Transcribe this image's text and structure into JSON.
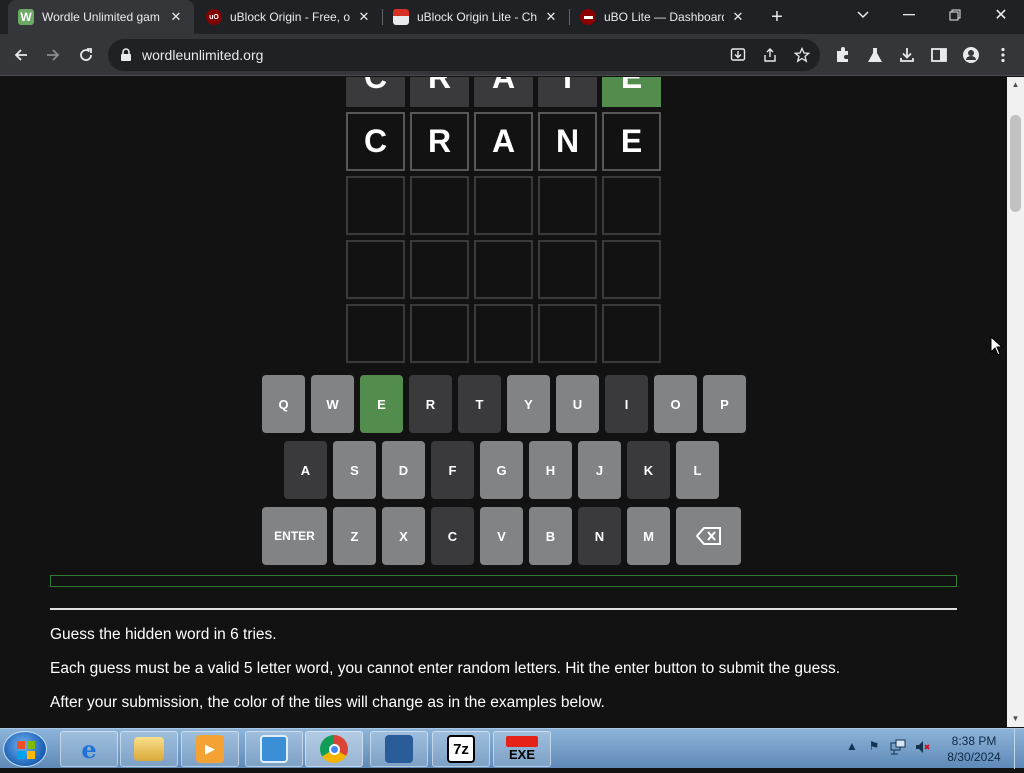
{
  "tabs": [
    {
      "title": "Wordle Unlimited gam",
      "favicon": "W",
      "active": true
    },
    {
      "title": "uBlock Origin - Free, o",
      "favicon": "uO",
      "active": false
    },
    {
      "title": "uBlock Origin Lite - Ch",
      "favicon": "ch",
      "active": false
    },
    {
      "title": "uBO Lite — Dashboard",
      "favicon": "ub",
      "active": false
    }
  ],
  "omnibox": {
    "url": "wordleunlimited.org"
  },
  "board": {
    "rows": [
      {
        "letters": [
          "C",
          "R",
          "A",
          "T",
          "E"
        ],
        "states": [
          "absent",
          "absent",
          "absent",
          "absent",
          "correct"
        ]
      },
      {
        "letters": [
          "C",
          "R",
          "A",
          "N",
          "E"
        ],
        "states": [
          "filled",
          "filled",
          "filled",
          "filled",
          "filled"
        ]
      },
      {
        "letters": [
          "",
          "",
          "",
          "",
          ""
        ],
        "states": [
          "empty",
          "empty",
          "empty",
          "empty",
          "empty"
        ]
      },
      {
        "letters": [
          "",
          "",
          "",
          "",
          ""
        ],
        "states": [
          "empty",
          "empty",
          "empty",
          "empty",
          "empty"
        ]
      },
      {
        "letters": [
          "",
          "",
          "",
          "",
          ""
        ],
        "states": [
          "empty",
          "empty",
          "empty",
          "empty",
          "empty"
        ]
      }
    ]
  },
  "keyboard": {
    "row1": [
      {
        "k": "Q",
        "s": "unused"
      },
      {
        "k": "W",
        "s": "unused"
      },
      {
        "k": "E",
        "s": "correct"
      },
      {
        "k": "R",
        "s": "absent"
      },
      {
        "k": "T",
        "s": "absent"
      },
      {
        "k": "Y",
        "s": "unused"
      },
      {
        "k": "U",
        "s": "unused"
      },
      {
        "k": "I",
        "s": "absent"
      },
      {
        "k": "O",
        "s": "unused"
      },
      {
        "k": "P",
        "s": "unused"
      }
    ],
    "row2": [
      {
        "k": "A",
        "s": "absent"
      },
      {
        "k": "S",
        "s": "unused"
      },
      {
        "k": "D",
        "s": "unused"
      },
      {
        "k": "F",
        "s": "absent"
      },
      {
        "k": "G",
        "s": "unused"
      },
      {
        "k": "H",
        "s": "unused"
      },
      {
        "k": "J",
        "s": "unused"
      },
      {
        "k": "K",
        "s": "absent"
      },
      {
        "k": "L",
        "s": "unused"
      }
    ],
    "row3": [
      {
        "k": "ENTER",
        "s": "unused"
      },
      {
        "k": "Z",
        "s": "unused"
      },
      {
        "k": "X",
        "s": "unused"
      },
      {
        "k": "C",
        "s": "absent"
      },
      {
        "k": "V",
        "s": "unused"
      },
      {
        "k": "B",
        "s": "unused"
      },
      {
        "k": "N",
        "s": "absent"
      },
      {
        "k": "M",
        "s": "unused"
      },
      {
        "k": "",
        "s": "unused",
        "icon": "backspace-icon"
      }
    ]
  },
  "instructions": [
    "Guess the hidden word in 6 tries.",
    "Each guess must be a valid 5 letter word, you cannot enter random letters. Hit the enter button to submit the guess.",
    "After your submission, the color of the tiles will change as in the examples below."
  ],
  "taskbar": {
    "apps": [
      {
        "name": "internet-explorer-icon",
        "label": ""
      },
      {
        "name": "file-explorer-icon",
        "label": ""
      },
      {
        "name": "media-player-icon",
        "label": ""
      },
      {
        "name": "control-panel-icon",
        "label": ""
      },
      {
        "name": "chrome-icon",
        "label": ""
      },
      {
        "name": "installer-icon",
        "label": ""
      },
      {
        "name": "7zip-icon",
        "label": "7z"
      },
      {
        "name": "youtube-exe-icon",
        "label": "EXE"
      }
    ],
    "clock": {
      "time": "8:38 PM",
      "date": "8/30/2024"
    }
  },
  "colors": {
    "correct": "#538d4e",
    "absent": "#3a3a3c",
    "unused": "#818384",
    "background": "#121213"
  }
}
